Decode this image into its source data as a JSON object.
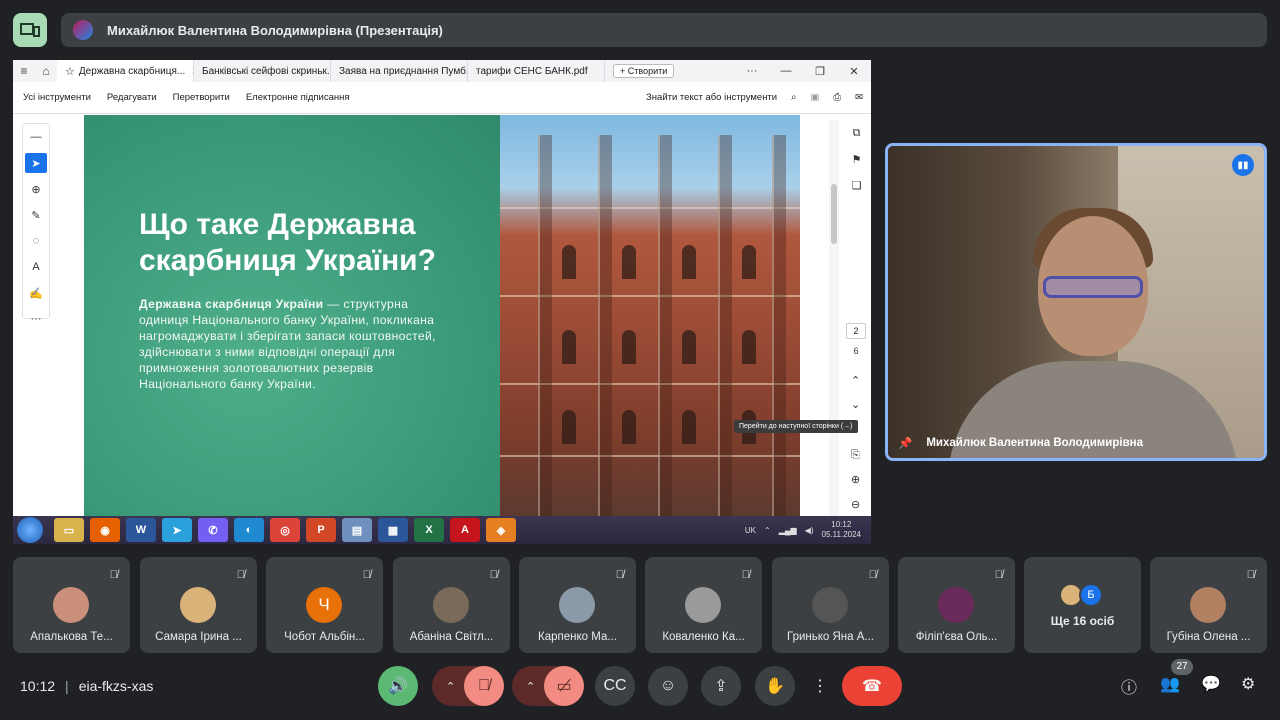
{
  "presentation": {
    "title": "Михайлюк Валентина Володимирівна (Презентація)"
  },
  "browser": {
    "tabs": [
      {
        "label": "Державна скарбниця...",
        "active": true
      },
      {
        "label": "Банківські сейфові скриньк...",
        "active": false
      },
      {
        "label": "Заява на приєднання Пумб...",
        "active": false
      },
      {
        "label": "тарифи СЕНС БАНК.pdf",
        "active": false
      }
    ],
    "new_tab_label": "Створити"
  },
  "pdf_toolbar": {
    "menus": [
      "Усі інструменти",
      "Редагувати",
      "Перетворити",
      "Електронне підписання"
    ],
    "search_label": "Знайти текст або інструменти"
  },
  "slide": {
    "title": "Що таке Державна скарбниця України?",
    "body_bold": "Державна скарбниця України",
    "body_rest": " — структурна одиниця Національного банку України, покликана нагромаджувати і зберігати запаси коштовностей, здійснювати з ними відповідні операції для примноження золотовалютних резервів Національного банку України."
  },
  "pdf_nav": {
    "current_page": "2",
    "total_pages": "6",
    "tooltip": "Перейти до наступної сторінки (→)"
  },
  "taskbar": {
    "lang": "UK",
    "time": "10:12",
    "date": "05.11.2024"
  },
  "self_view": {
    "name": "Михайлюк Валентина Володимирівна"
  },
  "participants": [
    {
      "name": "Апалькова Те...",
      "initial": "",
      "color": "#c98f7a"
    },
    {
      "name": "Самара Ірина ...",
      "initial": "",
      "color": "#d9b37a"
    },
    {
      "name": "Чобот Альбін...",
      "initial": "Ч",
      "color": "#e8710a"
    },
    {
      "name": "Абаніна Світл...",
      "initial": "",
      "color": "#7a6a5a"
    },
    {
      "name": "Карпенко Ма...",
      "initial": "",
      "color": "#8a9aa8"
    },
    {
      "name": "Коваленко Ка...",
      "initial": "",
      "color": "#9a9a9a"
    },
    {
      "name": "Гринько Яна А...",
      "initial": "",
      "color": "#555555"
    },
    {
      "name": "Філіп'єва Оль...",
      "initial": "",
      "color": "#6a2a5a"
    },
    {
      "name": "Губіна Олена ...",
      "initial": "",
      "color": "#b08060"
    }
  ],
  "more_tile": {
    "label": "Ще 16 осіб",
    "badge_initial": "Б"
  },
  "meeting": {
    "time": "10:12",
    "code": "eia-fkzs-xas",
    "participant_count": "27"
  }
}
